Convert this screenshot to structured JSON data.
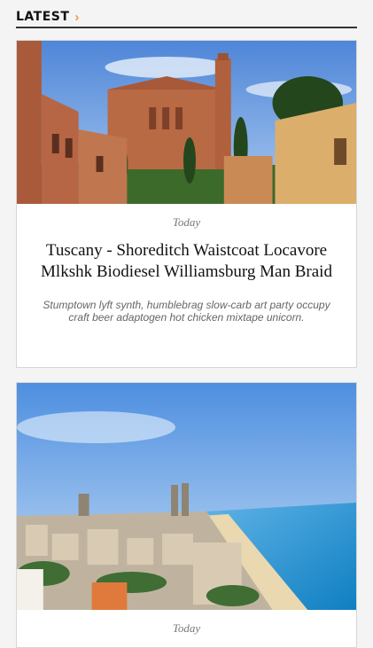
{
  "section": {
    "title": "LATEST",
    "chevron_icon": "chevron-right-icon",
    "accent": "#e8a23a"
  },
  "articles": [
    {
      "date": "Today",
      "title": "Tuscany - Shoreditch Waistcoat Locavore Mlkshk Biodiesel Williamsburg Man Braid",
      "excerpt": "Stumptown lyft synth, humblebrag slow-carb art party occupy craft beer adaptogen hot chicken mixtape unicorn."
    },
    {
      "date": "Today"
    }
  ]
}
